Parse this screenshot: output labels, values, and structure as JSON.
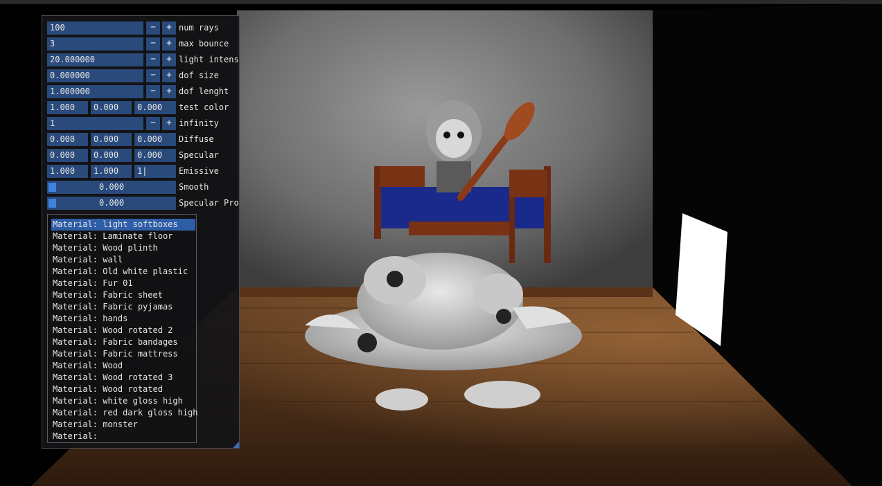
{
  "params": {
    "num_rays": {
      "value": "100",
      "label": "num rays"
    },
    "max_bounce": {
      "value": "3",
      "label": "max bounce"
    },
    "light_intensity": {
      "value": "20.000000",
      "label": "light intensi"
    },
    "dof_size": {
      "value": "0.000000",
      "label": "dof size"
    },
    "dof_length": {
      "value": "1.000000",
      "label": "dof lenght"
    },
    "test_color": {
      "r": "1.000",
      "g": "0.000",
      "b": "0.000",
      "label": "test color"
    },
    "infinity": {
      "value": "1",
      "label": "infinity"
    },
    "diffuse": {
      "r": "0.000",
      "g": "0.000",
      "b": "0.000",
      "label": "Diffuse"
    },
    "specular": {
      "r": "0.000",
      "g": "0.000",
      "b": "0.000",
      "label": "Specular"
    },
    "emissive": {
      "r": "1.000",
      "g": "1.000",
      "b": "1|",
      "label": "Emissive"
    },
    "smooth": {
      "value": "0.000",
      "label": "Smooth"
    },
    "specular_prob": {
      "value": "0.000",
      "label": "Specular Prob"
    }
  },
  "buttons": {
    "minus": "−",
    "plus": "+"
  },
  "materials": [
    "Material: light softboxes",
    "Material: Laminate floor",
    "Material: Wood plinth",
    "Material: wall",
    "Material: Old white plastic",
    "Material: Fur 01",
    "Material: Fabric sheet",
    "Material: Fabric pyjamas",
    "Material: hands",
    "Material: Wood rotated 2",
    "Material: Fabric bandages",
    "Material: Fabric mattress",
    "Material: Wood",
    "Material: Wood rotated 3",
    "Material: Wood rotated",
    "Material: white gloss high",
    "Material: red dark gloss high",
    "Material: monster",
    "Material: "
  ],
  "selected_material_index": 0,
  "colors": {
    "field_bg": "#294a7a",
    "slider_grab": "#3d84e0",
    "selected_item": "#2f5ea8",
    "panel_bg": "#141416"
  }
}
